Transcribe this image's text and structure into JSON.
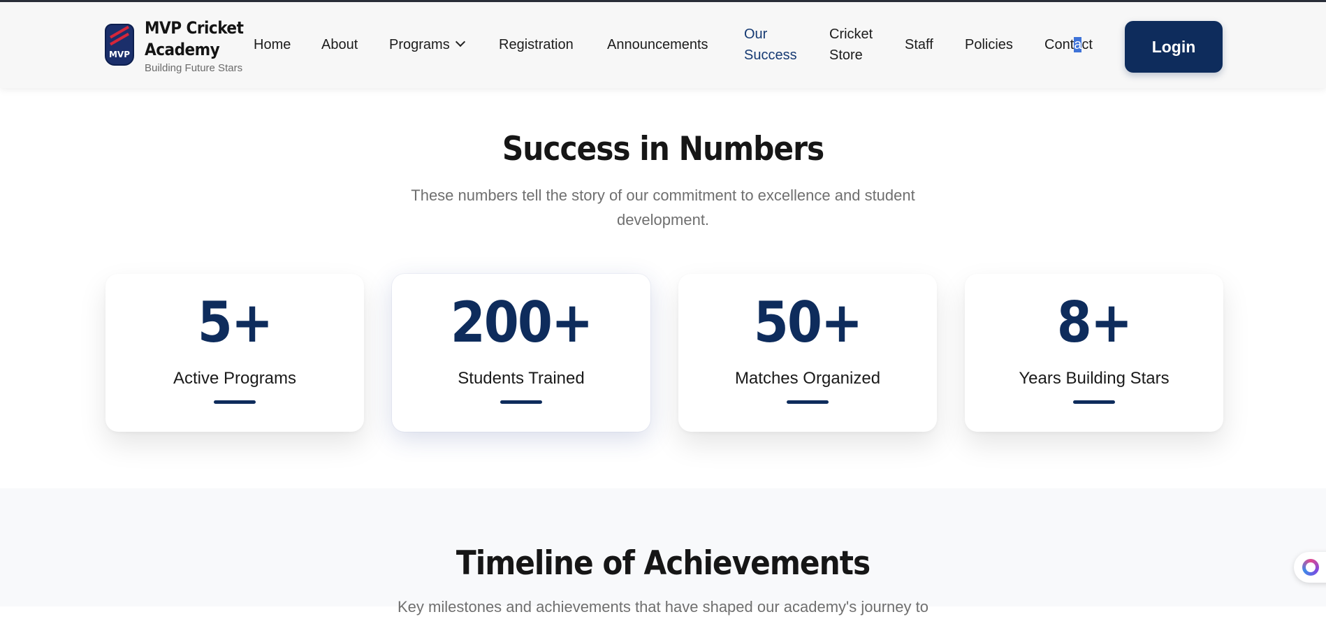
{
  "brand": {
    "logo_text": "MVP",
    "name": "MVP Cricket Academy",
    "tagline": "Building Future Stars"
  },
  "nav": {
    "home": "Home",
    "about": "About",
    "programs": "Programs",
    "registration": "Registration",
    "announcements": "Announcements",
    "our_success_1": "Our",
    "our_success_2": "Success",
    "store_1": "Cricket",
    "store_2": "Store",
    "staff": "Staff",
    "policies": "Policies",
    "contact_a": "Cont",
    "contact_b": "a",
    "contact_c": "ct",
    "login": "Login"
  },
  "numbers_section": {
    "title": "Success in Numbers",
    "subtitle_1": "These numbers tell the story of our commitment to excellence and student",
    "subtitle_2": "development."
  },
  "stats": [
    {
      "value": "5+",
      "label": "Active Programs"
    },
    {
      "value": "200+",
      "label": "Students Trained"
    },
    {
      "value": "50+",
      "label": "Matches Organized"
    },
    {
      "value": "8+",
      "label": "Years Building Stars"
    }
  ],
  "timeline_section": {
    "title": "Timeline of Achievements",
    "subtitle": "Key milestones and achievements that have shaped our academy's journey to"
  },
  "colors": {
    "primary": "#0e2c5c",
    "active_nav": "#163a73",
    "band_bg": "#f8f9fb"
  }
}
